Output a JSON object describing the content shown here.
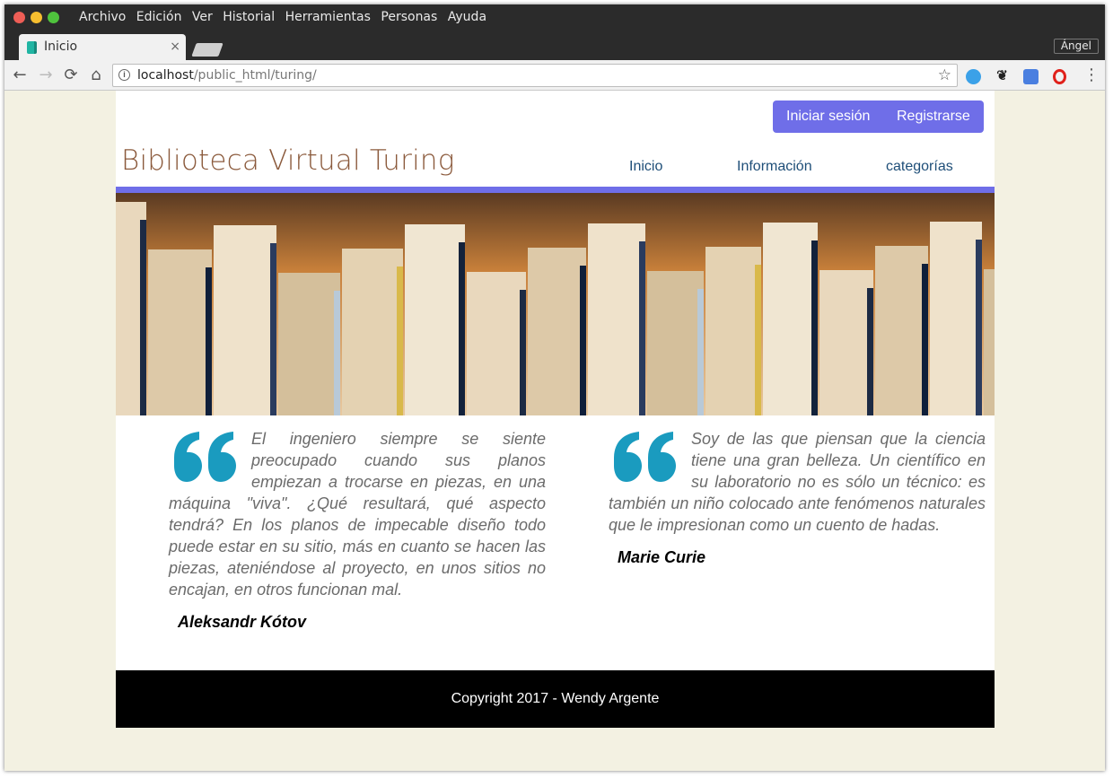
{
  "menubar": {
    "items": [
      "Archivo",
      "Edición",
      "Ver",
      "Historial",
      "Herramientas",
      "Personas",
      "Ayuda"
    ]
  },
  "tabs": {
    "active_title": "Inicio",
    "close_glyph": "×",
    "profile_name": "Ángel"
  },
  "toolbar": {
    "url_host": "localhost",
    "url_path": "/public_html/turing/",
    "back_glyph": "←",
    "forward_glyph": "→",
    "reload_glyph": "⟳",
    "home_glyph": "⌂",
    "star_glyph": "☆",
    "menu_glyph": "⋮",
    "icons": [
      "back-arrow-icon",
      "forward-arrow-icon",
      "reload-icon",
      "home-icon",
      "info-icon",
      "star-icon",
      "extension-icons",
      "menu-icon"
    ]
  },
  "header": {
    "login_label": "Iniciar sesión",
    "register_label": "Registrarse",
    "site_title": "Biblioteca Virtual Turing",
    "nav": [
      "Inicio",
      "Información",
      "categorías"
    ]
  },
  "quotes": [
    {
      "text": "El ingeniero siempre se siente preocupado cuando sus planos empiezan a trocarse en piezas, en una máquina \"viva\". ¿Qué resultará, qué aspecto tendrá? En los planos de impecable diseño todo puede estar en su sitio, más en cuanto se hacen las piezas, ateniéndose al proyecto, en unos sitios no encajan, en otros funcionan mal.",
      "author": "Aleksandr Kótov"
    },
    {
      "text": "Soy de las que piensan que la ciencia tiene una gran belleza. Un científico en su laboratorio no es sólo un técnico: es también un niño colocado ante fenómenos naturales que le impresionan como un cuento de hadas.",
      "author": "Marie Curie"
    }
  ],
  "footer": {
    "copyright": "Copyright 2017 - Wendy Argente"
  },
  "colors": {
    "accent": "#6f6ee8",
    "quote_mark": "#1a9bbf",
    "title_brown": "#8b5a3c",
    "nav_blue": "#1e4e78",
    "page_bg": "#f3f1e2"
  }
}
